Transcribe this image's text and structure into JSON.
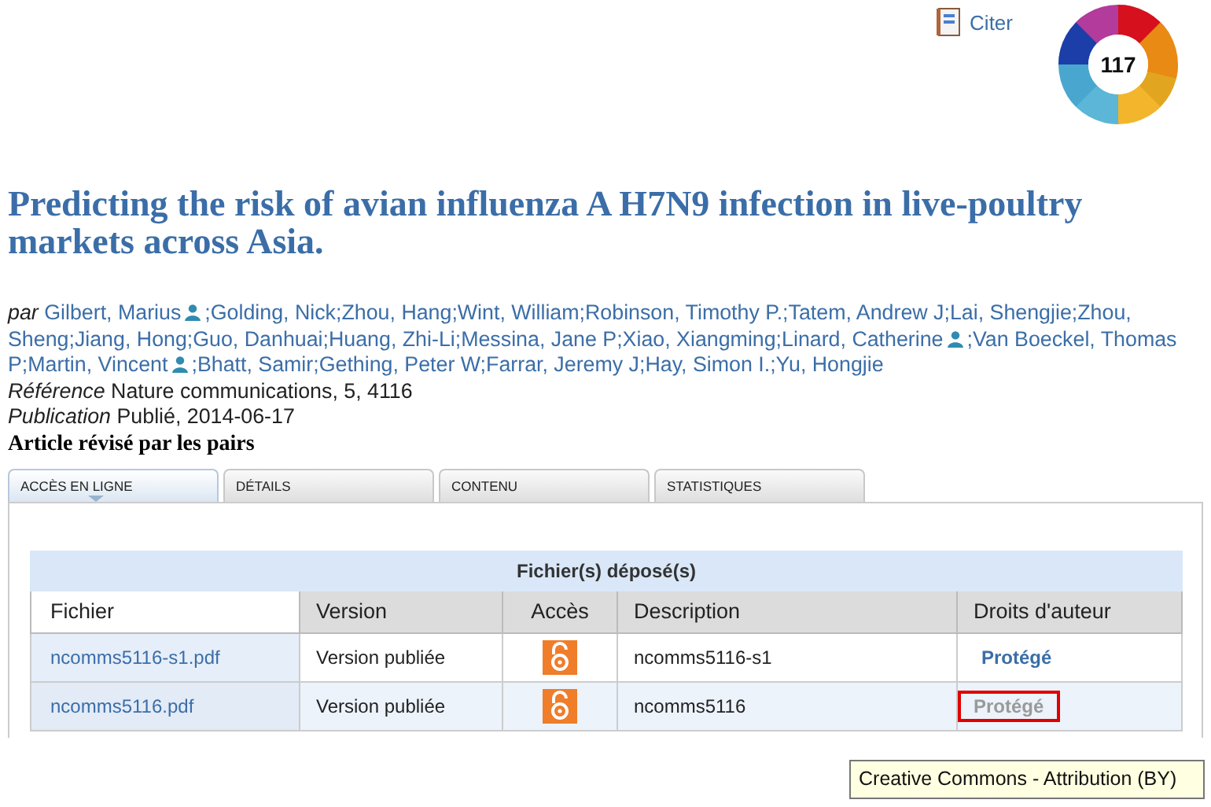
{
  "cite_link": "Citer",
  "altmetric_score": "117",
  "title": "Predicting the risk of avian influenza A H7N9 infection in live-poultry markets across Asia.",
  "authors_label": "par",
  "author_lines": [
    [
      {
        "text": "Gilbert, Marius",
        "profile": true
      },
      {
        "text": ";Golding, Nick;Zhou, Hang;Wint, William;Robinson, Timothy P.;Tatem, Andrew J;Lai, Shengjie;Zhou,",
        "profile": false
      }
    ],
    [
      {
        "text": "Sheng;Jiang, Hong;Guo, Danhuai;Huang, Zhi-Li;Messina, Jane P;Xiao, Xiangming;Linard, Catherine",
        "profile": true
      },
      {
        "text": ";Van Boeckel, Thomas",
        "profile": false
      }
    ],
    [
      {
        "text": "P;Martin, Vincent",
        "profile": true
      },
      {
        "text": ";Bhatt, Samir;Gething, Peter W;Farrar, Jeremy J;Hay, Simon I.;Yu, Hongjie",
        "profile": false
      }
    ]
  ],
  "meta": [
    {
      "label": "Référence",
      "value": "Nature communications, 5, 4116"
    },
    {
      "label": "Publication",
      "value": "Publié, 2014-06-17"
    }
  ],
  "peer_reviewed": "Article révisé par les pairs",
  "tabs": [
    {
      "label": "ACCÈS EN LIGNE",
      "selected": true
    },
    {
      "label": "DÉTAILS",
      "selected": false
    },
    {
      "label": "CONTENU",
      "selected": false
    },
    {
      "label": "STATISTIQUES",
      "selected": false
    }
  ],
  "table": {
    "caption": "Fichier(s) déposé(s)",
    "columns": [
      "Fichier",
      "Version",
      "Accès",
      "Description",
      "Droits d'auteur"
    ],
    "rows": [
      {
        "file": "ncomms5116-s1.pdf",
        "version": "Version publiée",
        "open_access": true,
        "description": "ncomms5116-s1",
        "rights": "Protégé",
        "highlighted": false
      },
      {
        "file": "ncomms5116.pdf",
        "version": "Version publiée",
        "open_access": true,
        "description": "ncomms5116",
        "rights": "Protégé",
        "highlighted": true
      }
    ]
  },
  "tooltip": "Creative Commons - Attribution (BY)"
}
